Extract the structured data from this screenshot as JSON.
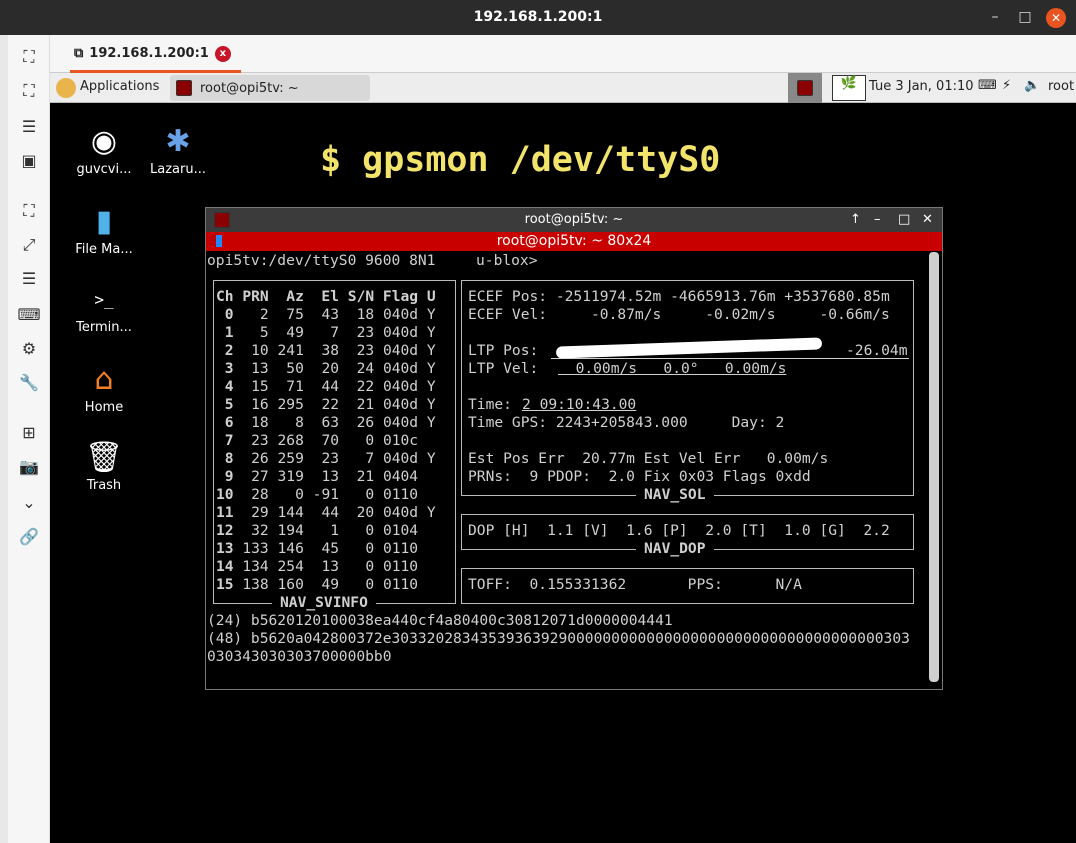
{
  "window": {
    "title": "192.168.1.200:1",
    "min": "–",
    "max": "□",
    "close": "✕"
  },
  "tab": {
    "label": "192.168.1.200:1",
    "close": "x"
  },
  "panel": {
    "applications": "Applications",
    "task": "root@opi5tv: ~",
    "clock": "Tue  3 Jan, 01:10",
    "user": "root"
  },
  "desktop": {
    "icons": [
      {
        "label": "guvcvi...",
        "icon": "webcam-icon"
      },
      {
        "label": "Lazaru...",
        "icon": "lazarus-icon"
      },
      {
        "label": "File Ma...",
        "icon": "file-manager-icon"
      },
      {
        "label": "Termin...",
        "icon": "terminal-icon"
      },
      {
        "label": "Home",
        "icon": "home-icon"
      },
      {
        "label": "Trash",
        "icon": "trash-icon"
      }
    ],
    "banner": "$ gpsmon /dev/ttyS0"
  },
  "terminal": {
    "title": "root@opi5tv: ~",
    "subtitle": "root@opi5tv: ~ 80x24",
    "status_line": "opi5tv:/dev/ttyS0 9600 8N1",
    "prompt": "u-blox>",
    "svinfo": {
      "label": "NAV_SVINFO",
      "header": "Ch PRN  Az  El S/N Flag U",
      "rows": [
        " 0   2  75  43  18 040d Y",
        " 1   5  49   7  23 040d Y",
        " 2  10 241  38  23 040d Y",
        " 3  13  50  20  24 040d Y",
        " 4  15  71  44  22 040d Y",
        " 5  16 295  22  21 040d Y",
        " 6  18   8  63  26 040d Y",
        " 7  23 268  70   0 010c",
        " 8  26 259  23   7 040d Y",
        " 9  27 319  13  21 0404",
        "10  28   0 -91   0 0110",
        "11  29 144  44  20 040d Y",
        "12  32 194   1   0 0104",
        "13 133 146  45   0 0110",
        "14 134 254  13   0 0110",
        "15 138 160  49   0 0110"
      ]
    },
    "sol": {
      "label": "NAV_SOL",
      "ecef_pos": "ECEF Pos: -2511974.52m -4665913.76m +3537680.85m",
      "ecef_vel": "ECEF Vel:     -0.87m/s     -0.02m/s     -0.66m/s",
      "ltp_pos_label": "LTP Pos:",
      "ltp_pos_alt": "-26.04m",
      "ltp_vel_label": "LTP Vel:",
      "ltp_vel": "  0.00m/s   0.0°   0.00m/s",
      "time_label": "Time:",
      "time": "2 09:10:43.00",
      "time_gps": "Time GPS: 2243+205843.000     Day: 2",
      "est": "Est Pos Err  20.77m Est Vel Err   0.00m/s",
      "prns": "PRNs:  9 PDOP:  2.0 Fix 0x03 Flags 0xdd"
    },
    "dop": {
      "label": "NAV_DOP",
      "line": "DOP [H]  1.1 [V]  1.6 [P]  2.0 [T]  1.0 [G]  2.2"
    },
    "toff": {
      "line": "TOFF:  0.155331362       PPS:      N/A"
    },
    "raw": [
      "(24) b5620120100038ea440cf4a80400c30812071d0000004441",
      "(48) b5620a042800372e30332028343539363929000000000000000000000000000000000000303",
      "030343030303700000bb0"
    ]
  }
}
